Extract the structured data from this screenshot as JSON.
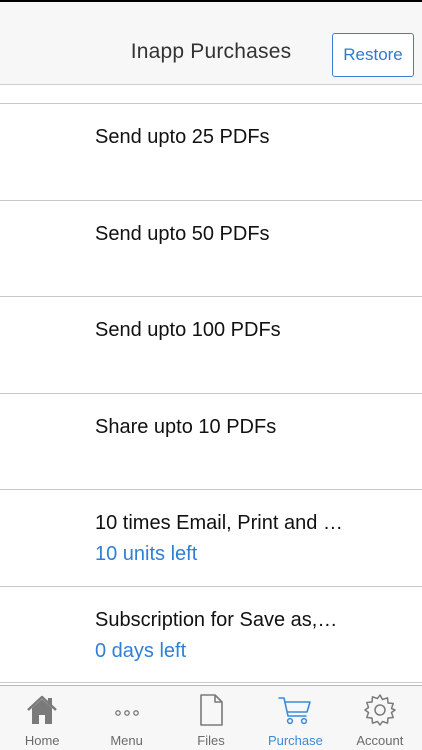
{
  "header": {
    "title": "Inapp Purchases",
    "restore_label": "Restore"
  },
  "purchases": [
    {
      "title": "Send upto 25 PDFs",
      "subtitle": ""
    },
    {
      "title": "Send upto 50 PDFs",
      "subtitle": ""
    },
    {
      "title": "Send upto 100 PDFs",
      "subtitle": ""
    },
    {
      "title": "Share upto 10 PDFs",
      "subtitle": ""
    },
    {
      "title": "10 times Email, Print and …",
      "subtitle": "10 units left"
    },
    {
      "title": "Subscription for Save as,…",
      "subtitle": "0 days left"
    }
  ],
  "tabbar": {
    "active": "Purchase",
    "accent": "#3a8ad8",
    "items": [
      {
        "label": "Home",
        "icon": "home-icon"
      },
      {
        "label": "Menu",
        "icon": "more-icon"
      },
      {
        "label": "Files",
        "icon": "file-icon"
      },
      {
        "label": "Purchase",
        "icon": "cart-icon"
      },
      {
        "label": "Account",
        "icon": "gear-icon"
      }
    ]
  }
}
